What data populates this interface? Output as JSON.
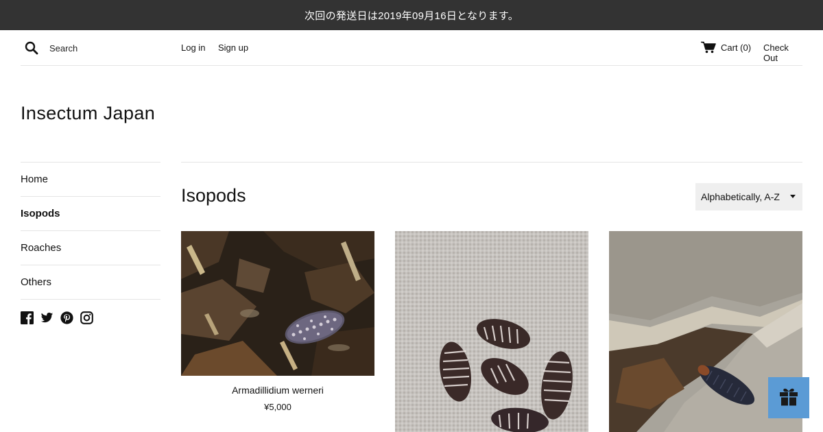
{
  "announcement": "次回の発送日は2019年09月16日となります。",
  "header": {
    "search_placeholder": "Search",
    "login": "Log in",
    "signup": "Sign up",
    "cart": "Cart (0)",
    "checkout": "Check Out"
  },
  "site_title": "Insectum Japan",
  "sidebar": {
    "items": [
      {
        "label": "Home"
      },
      {
        "label": "Isopods",
        "active": true
      },
      {
        "label": "Roaches"
      },
      {
        "label": "Others"
      }
    ],
    "social_icons": [
      "facebook-icon",
      "twitter-icon",
      "pinterest-icon",
      "instagram-icon"
    ]
  },
  "collection": {
    "title": "Isopods",
    "sort_value": "Alphabetically, A-Z"
  },
  "products": [
    {
      "name": "Armadillidium werneri",
      "price": "¥5,000"
    },
    {
      "name": "",
      "price": ""
    },
    {
      "name": "",
      "price": ""
    }
  ],
  "colors": {
    "announcement_bg": "#333333",
    "gift_button": "#5b9bd5",
    "sort_bg": "#efefef"
  }
}
